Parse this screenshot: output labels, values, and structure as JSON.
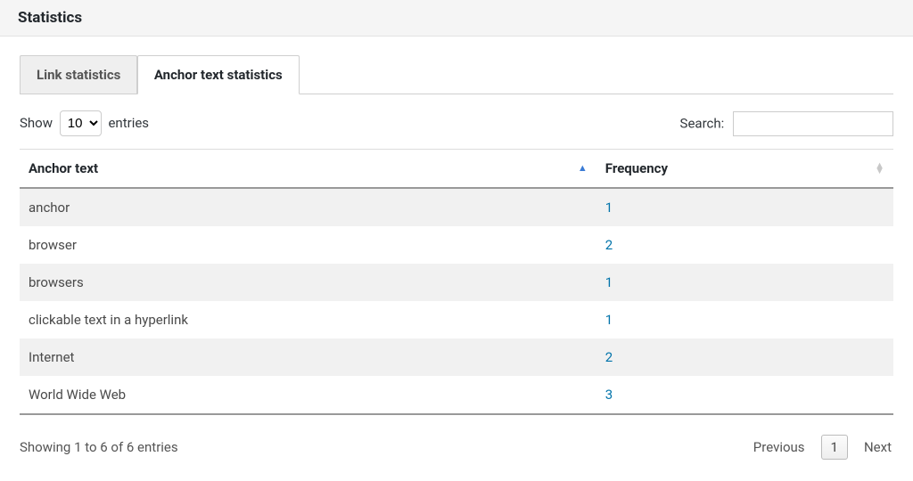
{
  "header": {
    "title": "Statistics"
  },
  "tabs": [
    {
      "label": "Link statistics",
      "active": false
    },
    {
      "label": "Anchor text statistics",
      "active": true
    }
  ],
  "length": {
    "prefix": "Show",
    "suffix": "entries",
    "value": "10"
  },
  "search": {
    "label": "Search:",
    "value": ""
  },
  "columns": {
    "anchor": "Anchor text",
    "freq": "Frequency"
  },
  "rows": [
    {
      "anchor": "anchor",
      "freq": "1"
    },
    {
      "anchor": "browser",
      "freq": "2"
    },
    {
      "anchor": "browsers",
      "freq": "1"
    },
    {
      "anchor": "clickable text in a hyperlink",
      "freq": "1"
    },
    {
      "anchor": "Internet",
      "freq": "2"
    },
    {
      "anchor": "World Wide Web",
      "freq": "3"
    }
  ],
  "info": "Showing 1 to 6 of 6 entries",
  "paginate": {
    "prev": "Previous",
    "next": "Next",
    "current": "1"
  }
}
